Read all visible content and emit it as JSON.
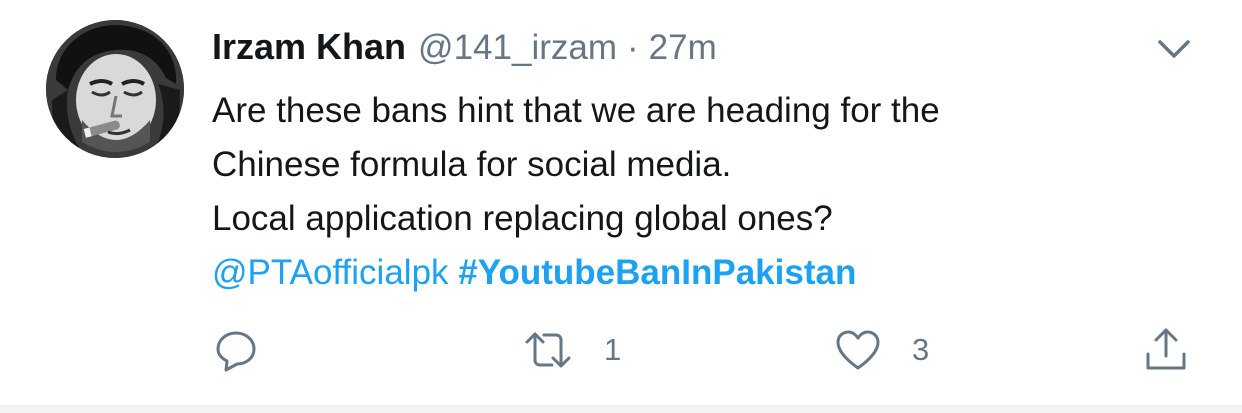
{
  "tweet": {
    "author_name": "Irzam Khan",
    "handle": "@141_irzam",
    "separator": "·",
    "time": "27m",
    "text_lines": [
      "Are these bans hint that we are heading for the",
      "Chinese formula for social media.",
      "Local application replacing global ones?"
    ],
    "mention": "@PTAofficialpk",
    "hashtag": "#YoutubeBanInPakistan"
  },
  "actions": {
    "reply_icon": "reply-icon",
    "retweet_icon": "retweet-icon",
    "retweet_count": "1",
    "like_icon": "heart-icon",
    "like_count": "3",
    "share_icon": "share-icon"
  },
  "colors": {
    "text": "#14171a",
    "secondary": "#657786",
    "link": "#1da1f2",
    "divider": "#f2f4f5"
  }
}
